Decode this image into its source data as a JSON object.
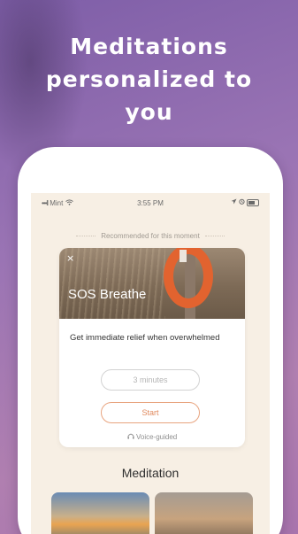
{
  "headline": {
    "line1": "Meditations",
    "line2": "personalized to",
    "line3": "you"
  },
  "status_bar": {
    "carrier": "Mint",
    "time": "3:55 PM",
    "signal_icon": "signal-icon",
    "wifi_icon": "wifi-icon",
    "location_icon": "location-arrow-icon",
    "alarm_icon": "alarm-icon",
    "battery_icon": "battery-icon"
  },
  "recommendation": {
    "label": "Recommended for this moment",
    "card": {
      "close_glyph": "×",
      "title": "SOS Breathe",
      "description": "Get immediate relief when overwhelmed",
      "duration": "3 minutes",
      "start_label": "Start",
      "voice_label": "Voice-guided",
      "voice_icon": "headphones-icon"
    }
  },
  "section": {
    "title": "Meditation"
  },
  "colors": {
    "accent": "#e08a5e",
    "background_top": "#7e5ea8",
    "screen_bg": "#f7efe4"
  }
}
